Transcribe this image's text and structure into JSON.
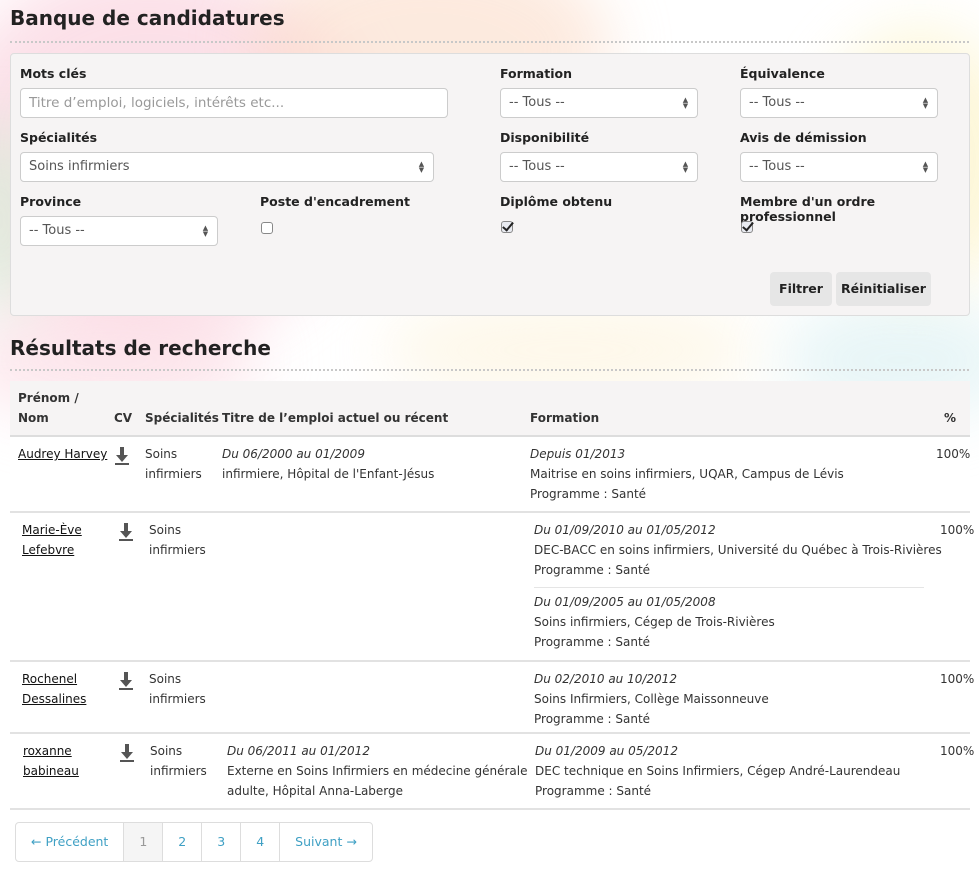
{
  "header": {
    "title": "Banque de candidatures"
  },
  "filters": {
    "keywords": {
      "label": "Mots clés",
      "placeholder": "Titre d’emploi, logiciels, intérêts etc...",
      "value": ""
    },
    "formation": {
      "label": "Formation",
      "value": "-- Tous --"
    },
    "equivalence": {
      "label": "Équivalence",
      "value": "-- Tous --"
    },
    "specialites": {
      "label": "Spécialités",
      "value": "Soins infirmiers"
    },
    "disponibilite": {
      "label": "Disponibilité",
      "value": "-- Tous --"
    },
    "avis_demission": {
      "label": "Avis de démission",
      "value": "-- Tous --"
    },
    "province": {
      "label": "Province",
      "value": "-- Tous --"
    },
    "poste_encadrement": {
      "label": "Poste d'encadrement",
      "checked": false
    },
    "diplome_obtenu": {
      "label": "Diplôme obtenu",
      "checked": true
    },
    "membre_ordre": {
      "label": "Membre d'un ordre professionnel",
      "checked": true
    },
    "filter_button": "Filtrer",
    "reset_button": "Réinitialiser"
  },
  "results": {
    "title": "Résultats de recherche",
    "columns": {
      "name_line1": "Prénom /",
      "name_line2": "Nom",
      "cv": "CV",
      "specialites": "Spécialités",
      "job": "Titre de l’emploi actuel ou récent",
      "formation": "Formation",
      "percent": "%"
    },
    "rows": [
      {
        "name1": "Audrey Harvey",
        "name2": "",
        "spec1": "Soins",
        "spec2": "infirmiers",
        "job_dates": "Du 06/2000 au 01/2009",
        "job_line1": "infirmiere, Hôpital de l'Enfant-Jésus",
        "job_line2": "",
        "formations": [
          {
            "dates": "Depuis 01/2013",
            "title": "Maitrise en soins infirmiers, UQAR, Campus de Lévis",
            "program": "Programme : Santé"
          }
        ],
        "percent": "100%"
      },
      {
        "name1": "Marie-Ève",
        "name2": "Lefebvre",
        "spec1": "Soins",
        "spec2": "infirmiers",
        "job_dates": "",
        "job_line1": "",
        "job_line2": "",
        "formations": [
          {
            "dates": "Du 01/09/2010 au 01/05/2012",
            "title": "DEC-BACC en soins infirmiers, Université du Québec à Trois-Rivières",
            "program": "Programme : Santé"
          },
          {
            "dates": "Du 01/09/2005 au 01/05/2008",
            "title": "Soins infirmiers, Cégep de Trois-Rivières",
            "program": "Programme : Santé"
          }
        ],
        "percent": "100%"
      },
      {
        "name1": "Rochenel",
        "name2": "Dessalines",
        "spec1": "Soins",
        "spec2": "infirmiers",
        "job_dates": "",
        "job_line1": "",
        "job_line2": "",
        "formations": [
          {
            "dates": "Du 02/2010 au 10/2012",
            "title": "Soins Infirmiers, Collège Maissonneuve",
            "program": "Programme : Santé"
          }
        ],
        "percent": "100%"
      },
      {
        "name1": "roxanne",
        "name2": "babineau",
        "spec1": "Soins",
        "spec2": "infirmiers",
        "job_dates": "Du 06/2011 au 01/2012",
        "job_line1": "Externe en Soins Infirmiers en médecine générale",
        "job_line2": "adulte, Hôpital Anna-Laberge",
        "formations": [
          {
            "dates": "Du 01/2009 au 05/2012",
            "title": "DEC technique en Soins Infirmiers, Cégep André-Laurendeau",
            "program": "Programme : Santé"
          }
        ],
        "percent": "100%"
      }
    ]
  },
  "pagination": {
    "prev": "← Précédent",
    "pages": [
      "1",
      "2",
      "3",
      "4"
    ],
    "active_page": "1",
    "next": "Suivant →"
  },
  "colors": {
    "link": "#3fa0c4",
    "panel_bg": "#f6f4f4",
    "button_bg": "#e6e6e6"
  }
}
